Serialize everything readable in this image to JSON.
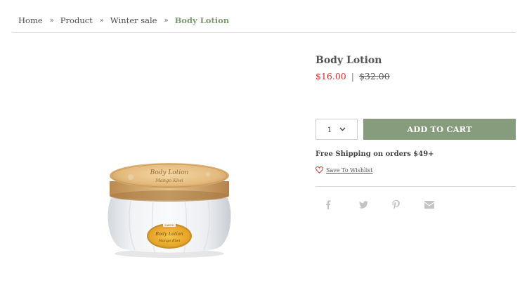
{
  "breadcrumb": {
    "items": [
      "Home",
      "Product",
      "Winter sale",
      "Body Lotion"
    ],
    "separator": "»"
  },
  "product": {
    "title": "Body Lotion",
    "price_sale": "$16.00",
    "price_separator": "|",
    "price_original": "$32.00",
    "image_label_line1": "Body Lotion",
    "image_label_line2": "Mango Kiwi",
    "image_brand": "SABON"
  },
  "quantity": {
    "value": "1"
  },
  "cart": {
    "add_label": "ADD TO CART"
  },
  "shipping": {
    "text": "Free Shipping on orders $49+"
  },
  "wishlist": {
    "label": "Save To Wishlist"
  },
  "share": {
    "icons": [
      "facebook-icon",
      "twitter-icon",
      "pinterest-icon",
      "email-icon"
    ]
  },
  "colors": {
    "accent_green": "#879c7c",
    "breadcrumb_current": "#7f9a73",
    "sale_price": "#d0312d",
    "share_icon": "#c4c4c4"
  }
}
